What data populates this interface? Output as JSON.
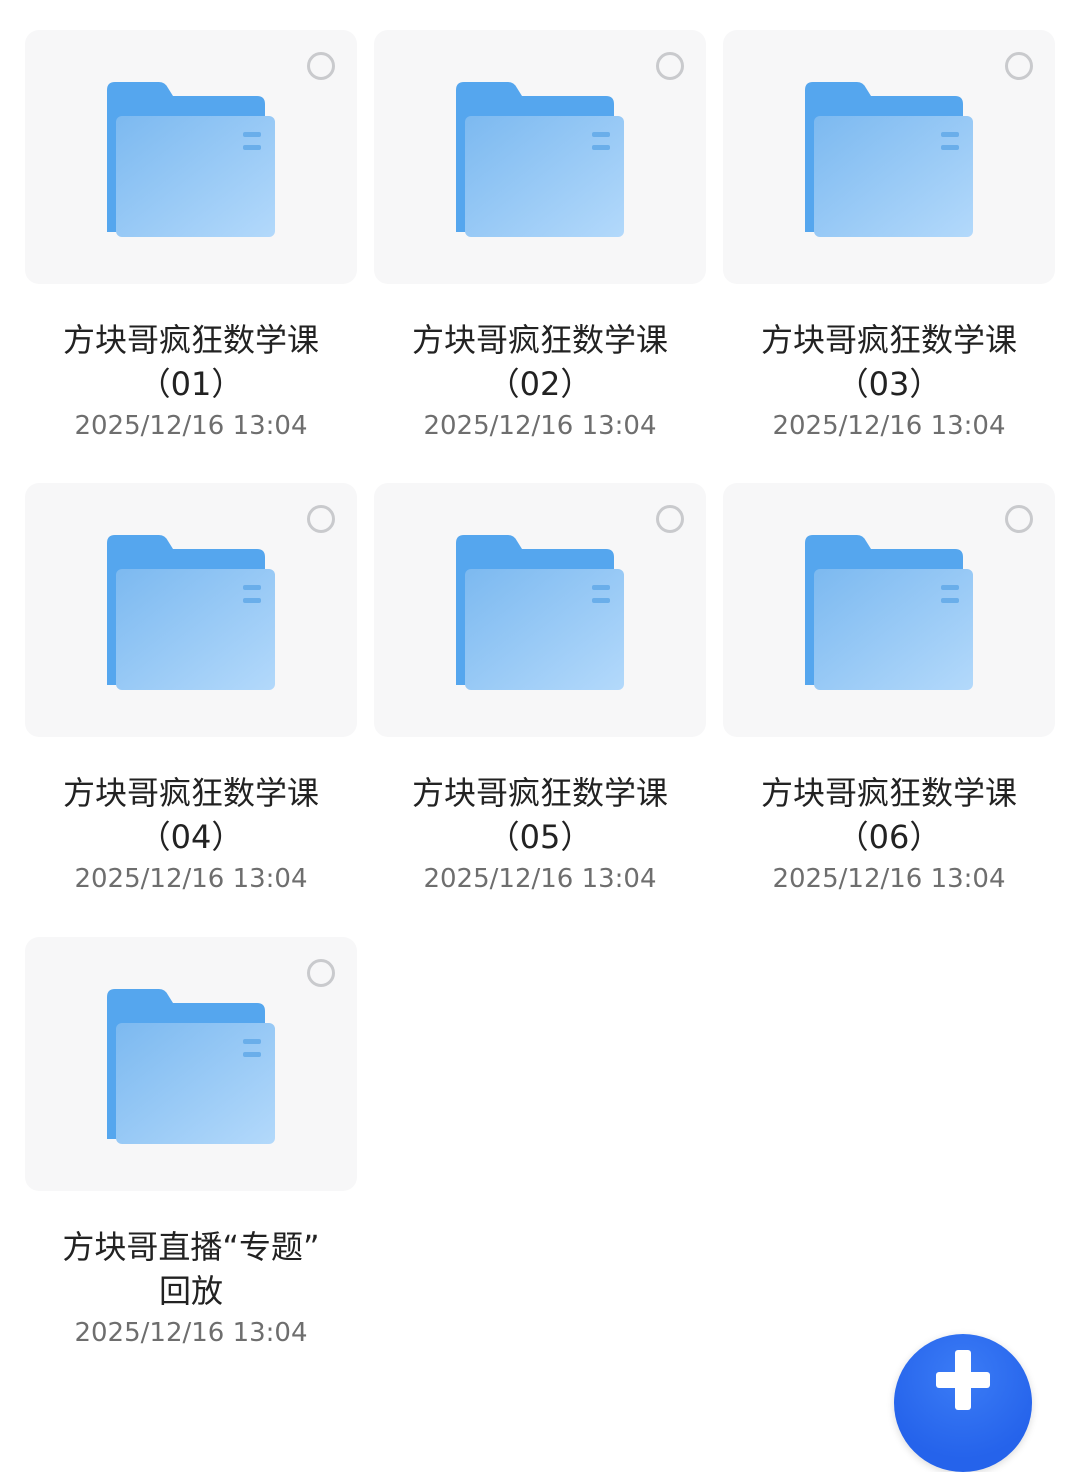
{
  "folders": [
    {
      "name": "方块哥疯狂数学课\n（01）",
      "date": "2025/12/16 13:04"
    },
    {
      "name": "方块哥疯狂数学课\n（02）",
      "date": "2025/12/16 13:04"
    },
    {
      "name": "方块哥疯狂数学课\n（03）",
      "date": "2025/12/16 13:04"
    },
    {
      "name": "方块哥疯狂数学课\n（04）",
      "date": "2025/12/16 13:04"
    },
    {
      "name": "方块哥疯狂数学课\n（05）",
      "date": "2025/12/16 13:04"
    },
    {
      "name": "方块哥疯狂数学课\n（06）",
      "date": "2025/12/16 13:04"
    },
    {
      "name": "方块哥直播“专题”\n回放",
      "date": "2025/12/16 13:04"
    }
  ],
  "icons": {
    "folder": "folder-icon",
    "select": "selection-circle-icon",
    "fab": "plus-icon"
  },
  "colors": {
    "folder_back": "#55a6ee",
    "folder_front": "#8cc5f5",
    "fab": "#2563eb",
    "card_bg": "#f7f7f8"
  }
}
